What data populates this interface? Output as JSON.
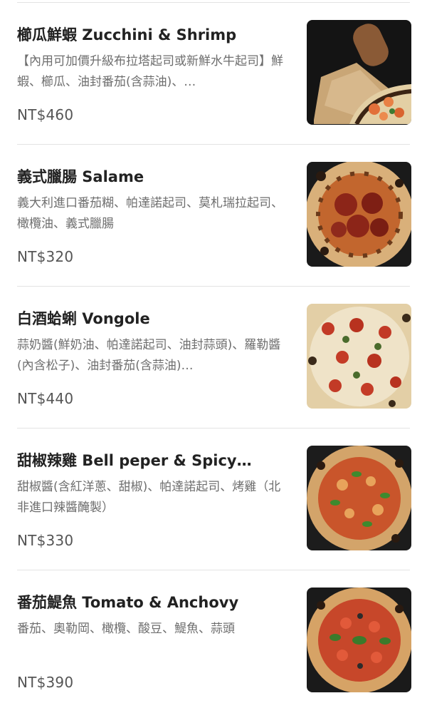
{
  "items": [
    {
      "name": "櫛瓜鮮蝦 Zucchini & Shrimp",
      "desc": "【內用可加價升級布拉塔起司或新鮮水牛起司】鮮蝦、櫛瓜、油封番茄(含蒜油)、…",
      "price": "NT$460",
      "photo": "shrimp-pizza-icon"
    },
    {
      "name": "義式臘腸 Salame",
      "desc": "義大利進口番茄糊、帕達諾起司、莫札瑞拉起司、橄欖油、義式臘腸",
      "price": "NT$320",
      "photo": "salame-pizza-icon"
    },
    {
      "name": "白酒蛤蜊 Vongole",
      "desc": "蒜奶醬(鮮奶油、帕達諾起司、油封蒜頭)、羅勒醬(內含松子)、油封番茄(含蒜油)…",
      "price": "NT$440",
      "photo": "vongole-pizza-icon"
    },
    {
      "name": "甜椒辣雞 Bell peper & Spicy…",
      "desc": "甜椒醬(含紅洋蔥、甜椒)、帕達諾起司、烤雞（北非進口辣醬醃製）",
      "price": "NT$330",
      "photo": "bell-pepper-chicken-pizza-icon"
    },
    {
      "name": "番茄鯷魚 Tomato & Anchovy",
      "desc": "番茄、奧勒岡、橄欖、酸豆、鯷魚、蒜頭",
      "price": "NT$390",
      "photo": "tomato-anchovy-pizza-icon"
    }
  ]
}
